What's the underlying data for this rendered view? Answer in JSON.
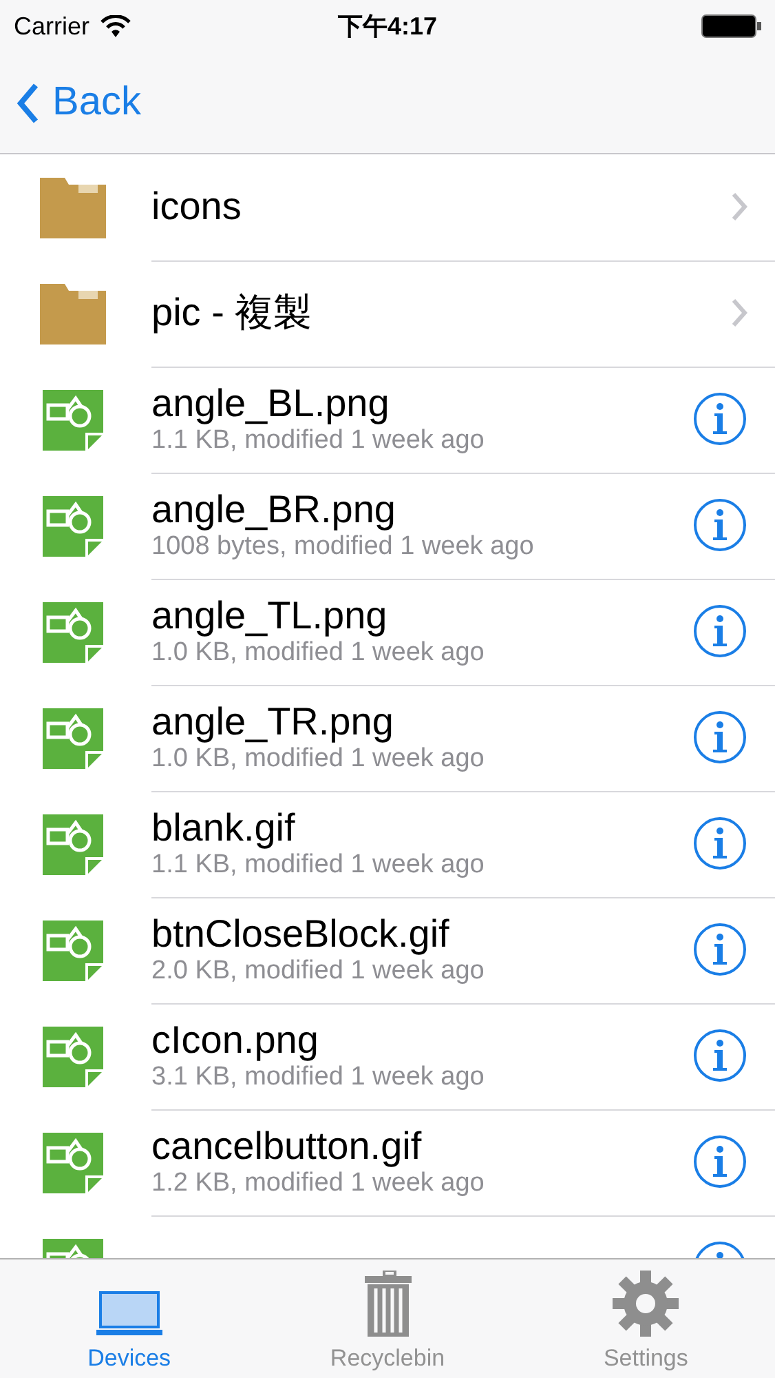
{
  "status_bar": {
    "carrier": "Carrier",
    "time": "下午4:17"
  },
  "nav": {
    "back": "Back"
  },
  "items": [
    {
      "kind": "folder",
      "name": "icons"
    },
    {
      "kind": "folder",
      "name": "pic - 複製"
    },
    {
      "kind": "file",
      "name": "angle_BL.png",
      "detail": "1.1 KB, modified 1 week ago"
    },
    {
      "kind": "file",
      "name": "angle_BR.png",
      "detail": "1008 bytes, modified 1 week ago"
    },
    {
      "kind": "file",
      "name": "angle_TL.png",
      "detail": "1.0 KB, modified 1 week ago"
    },
    {
      "kind": "file",
      "name": "angle_TR.png",
      "detail": "1.0 KB, modified 1 week ago"
    },
    {
      "kind": "file",
      "name": "blank.gif",
      "detail": "1.1 KB, modified 1 week ago"
    },
    {
      "kind": "file",
      "name": "btnCloseBlock.gif",
      "detail": "2.0 KB, modified 1 week ago"
    },
    {
      "kind": "file",
      "name": "cIcon.png",
      "detail": "3.1 KB, modified 1 week ago"
    },
    {
      "kind": "file",
      "name": "cancelbutton.gif",
      "detail": "1.2 KB, modified 1 week ago"
    },
    {
      "kind": "file"
    }
  ],
  "tabs": [
    {
      "label": "Devices",
      "kind": "devices",
      "selected": true
    },
    {
      "label": "Recyclebin",
      "kind": "trash",
      "selected": false
    },
    {
      "label": "Settings",
      "kind": "settings",
      "selected": false
    }
  ]
}
